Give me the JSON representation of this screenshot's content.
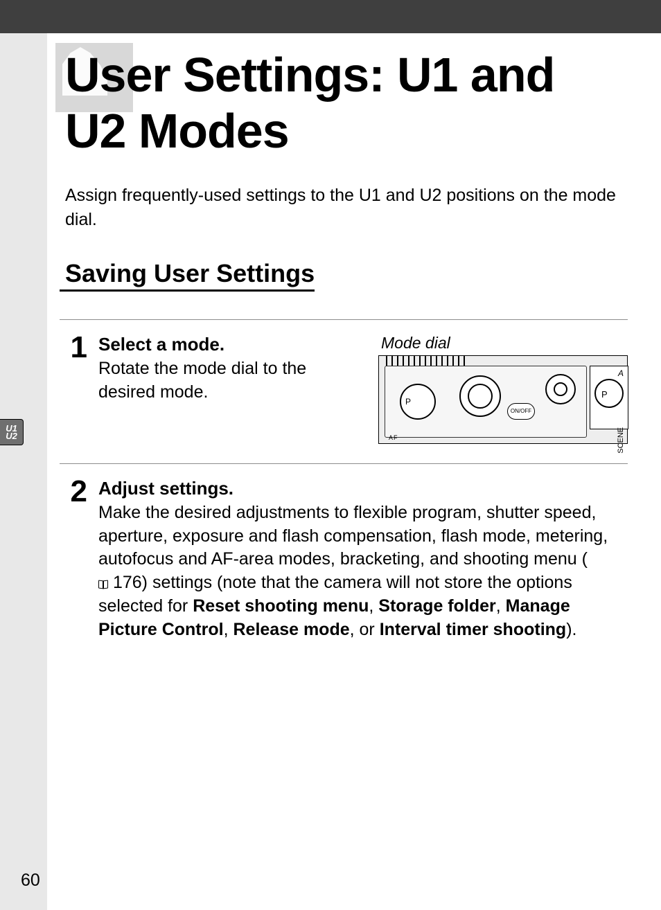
{
  "title": "User Settings: U1 and U2 Modes",
  "intro_parts": {
    "a": "Assign frequently-used settings to the ",
    "u1": "U1",
    "b": " and ",
    "u2": "U2",
    "c": " positions on the mode dial."
  },
  "section_heading": "Saving User Settings",
  "steps": [
    {
      "num": "1",
      "heading": "Select a mode.",
      "body": "Rotate the mode dial to the desired mode.",
      "figure_caption": "Mode dial",
      "fig_labels": {
        "onoff": "ON/OFF",
        "scene": "SCENE",
        "a": "A",
        "p1": "P",
        "p2": "P",
        "af": "AF"
      }
    },
    {
      "num": "2",
      "heading": "Adjust settings.",
      "body_parts": {
        "a": "Make the desired adjustments to flexible program, shutter speed, aperture, exposure and flash compensation, flash mode, metering, autofocus and AF-area modes, bracketing, and shooting menu (",
        "ref": "176",
        "b": ") settings (note that the camera will not store the options selected for ",
        "bold1": "Reset shooting menu",
        "c": ", ",
        "bold2": "Storage folder",
        "d": ", ",
        "bold3": "Manage Picture Control",
        "e": ", ",
        "bold4": "Release mode",
        "f": ", or ",
        "bold5": "Interval timer shooting",
        "g": ")."
      }
    }
  ],
  "tab_label": "U1\nU2",
  "page_number": "60"
}
